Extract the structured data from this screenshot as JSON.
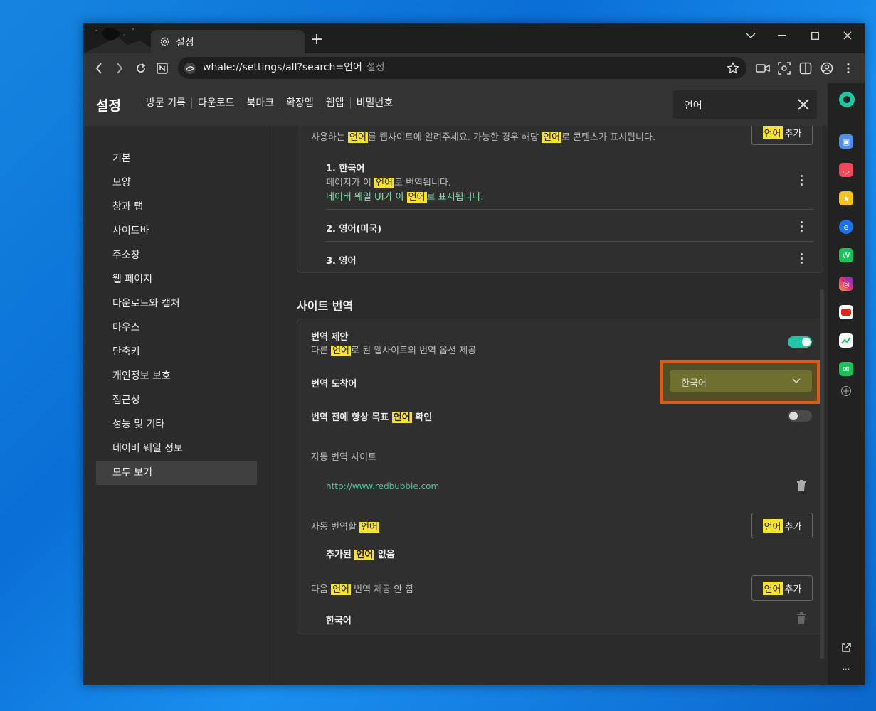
{
  "tab": {
    "title": "설정"
  },
  "address": {
    "url": "whale://settings/all?search=언어",
    "suffix": "설정"
  },
  "header": {
    "title": "설정",
    "nav": [
      "방문 기록",
      "다운로드",
      "북마크",
      "확장앱",
      "웹앱",
      "비밀번호"
    ]
  },
  "search": {
    "value": "언어"
  },
  "sidebar": {
    "items": [
      "기본",
      "모양",
      "창과 탭",
      "사이드바",
      "주소창",
      "웹 페이지",
      "다운로드와 캡처",
      "마우스",
      "단축키",
      "개인정보 보호",
      "접근성",
      "성능 및 기타",
      "네이버 웨일 정보",
      "모두 보기"
    ],
    "selected": "모두 보기"
  },
  "language": {
    "desc_pre": "사용하는 ",
    "desc_hl": "언어",
    "desc_mid": "를 웹사이트에 알려주세요. 가능한 경우 해당 ",
    "desc_hl2": "언어",
    "desc_post": "로 콘텐츠가 표시됩니다.",
    "add_hl": "언어",
    "add_label": "추가",
    "items": [
      {
        "name": "1. 한국어",
        "line1_pre": "페이지가 이 ",
        "line1_hl": "언어",
        "line1_post": "로 번역됩니다.",
        "line2_pre": "네이버 웨일 UI가 이 ",
        "line2_hl": "언어",
        "line2_post": "로 표시됩니다."
      },
      {
        "name": "2. 영어(미국)"
      },
      {
        "name": "3. 영어"
      }
    ]
  },
  "translate": {
    "section_title": "사이트 번역",
    "offer_title": "번역 제안",
    "offer_desc_pre": "다른 ",
    "offer_desc_hl": "언어",
    "offer_desc_post": "로 된 웹사이트의 번역 옵션 제공",
    "offer_on": true,
    "target_label": "번역 도착어",
    "target_value": "한국어",
    "confirm_pre": "번역 전에 항상 목표 ",
    "confirm_hl": "언어",
    "confirm_post": " 확인",
    "confirm_on": false,
    "auto_sites_label": "자동 번역 사이트",
    "auto_site": "http://www.redbubble.com",
    "auto_lang_pre": "자동 번역할 ",
    "auto_lang_hl": "언어",
    "none_pre": "추가된 ",
    "none_hl": "언어",
    "none_post": " 없음",
    "never_pre": "다음 ",
    "never_hl": "언어",
    "never_post": " 번역 제공 안 함",
    "never_item": "한국어",
    "add_hl": "언어",
    "add_label": "추가"
  },
  "colors": {
    "accent": "#1ec8a5",
    "highlight": "#f5e130",
    "focus_box": "#e05a12"
  }
}
